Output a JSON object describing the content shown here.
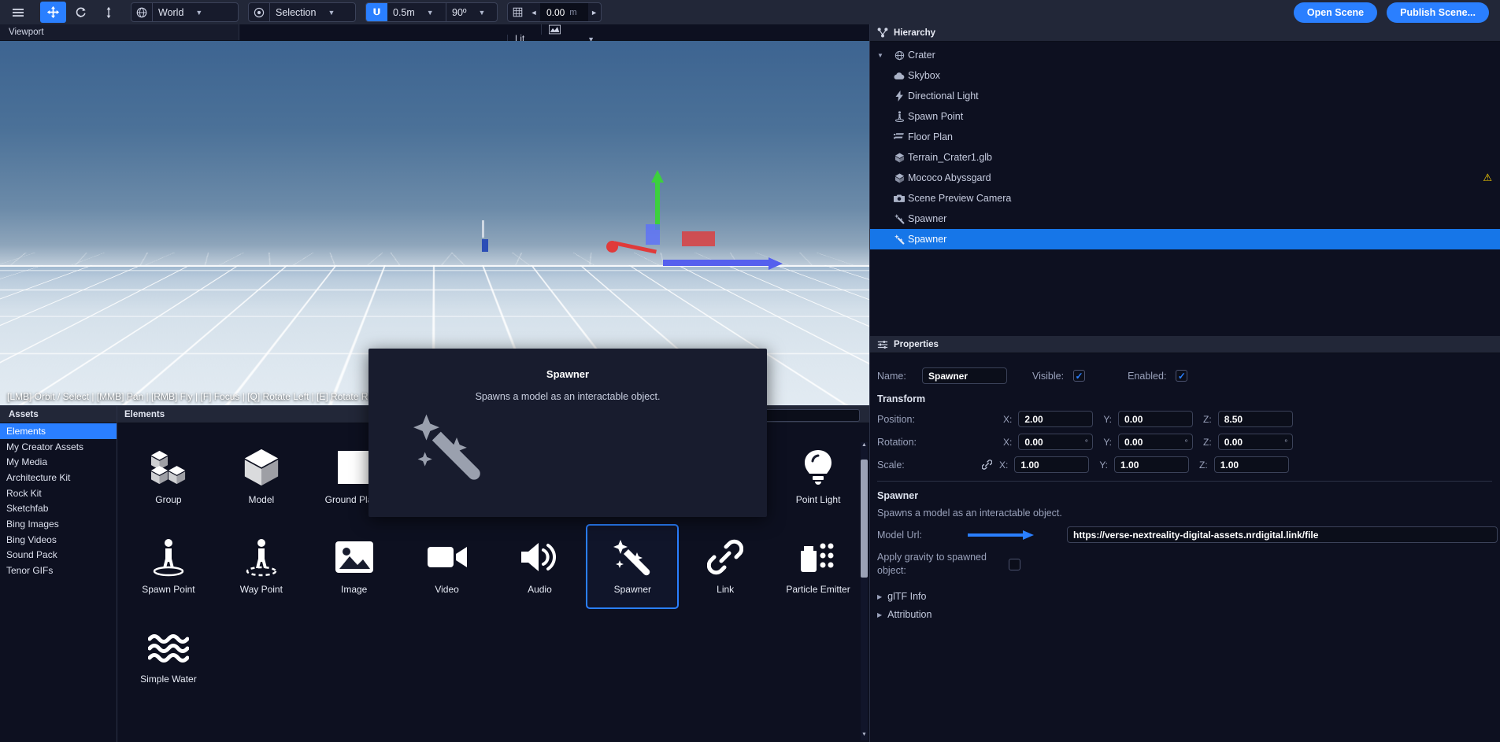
{
  "toolbar": {
    "menu_icon": "hamburger-menu-icon",
    "tools": [
      {
        "name": "move-tool",
        "icon": "move-arrows-icon",
        "active": true
      },
      {
        "name": "rotate-tool",
        "icon": "rotate-icon",
        "active": false
      },
      {
        "name": "scale-tool",
        "icon": "scale-vertical-icon",
        "active": false
      }
    ],
    "coord_space": {
      "icon": "globe-icon",
      "value": "World"
    },
    "pivot": {
      "icon": "target-icon",
      "value": "Selection"
    },
    "snap": {
      "icon": "magnet-icon",
      "translate": "0.5m",
      "rotate": "90º"
    },
    "grid": {
      "icon": "grid-icon",
      "value": "0.00",
      "unit": "m",
      "left_arrow": "◄",
      "right_arrow": "►"
    },
    "open_scene": "Open Scene",
    "publish_scene": "Publish Scene..."
  },
  "viewport": {
    "title": "Viewport",
    "stats_icon": "chart-icon",
    "shading": "Lit",
    "hint": "[LMB] Orbit / Select | [MMB] Pan | [RMB] Fly | [F] Focus | [Q] Rotate Left | [E] Rotate Right| [G] G"
  },
  "tooltip": {
    "title": "Spawner",
    "description": "Spawns a model as an interactable object.",
    "icon": "magic-wand-icon"
  },
  "assets": {
    "panel_title": "Assets",
    "categories": [
      {
        "label": "Elements",
        "selected": true
      },
      {
        "label": "My Creator Assets",
        "selected": false
      },
      {
        "label": "My Media",
        "selected": false
      },
      {
        "label": "Architecture Kit",
        "selected": false
      },
      {
        "label": "Rock Kit",
        "selected": false
      },
      {
        "label": "Sketchfab",
        "selected": false
      },
      {
        "label": "Bing Images",
        "selected": false
      },
      {
        "label": "Bing Videos",
        "selected": false
      },
      {
        "label": "Sound Pack",
        "selected": false
      },
      {
        "label": "Tenor GIFs",
        "selected": false
      }
    ],
    "content_title": "Elements",
    "search_placeholder": "",
    "search_value": "",
    "items": [
      {
        "label": "Group",
        "icon": "group-cubes-icon",
        "selected": false
      },
      {
        "label": "Model",
        "icon": "cube-icon",
        "selected": false
      },
      {
        "label": "Ground Plane",
        "icon": "square-icon",
        "selected": false
      },
      {
        "label": "",
        "icon": "",
        "selected": false
      },
      {
        "label": "",
        "icon": "",
        "selected": false
      },
      {
        "label": "",
        "icon": "",
        "selected": false
      },
      {
        "label": "",
        "icon": "",
        "selected": false
      },
      {
        "label": "Point Light",
        "icon": "bulb-icon",
        "selected": false
      },
      {
        "label": "Spawn Point",
        "icon": "spawn-point-icon",
        "selected": false
      },
      {
        "label": "Way Point",
        "icon": "way-point-icon",
        "selected": false
      },
      {
        "label": "Image",
        "icon": "image-icon",
        "selected": false
      },
      {
        "label": "Video",
        "icon": "video-camera-icon",
        "selected": false
      },
      {
        "label": "Audio",
        "icon": "speaker-icon",
        "selected": false
      },
      {
        "label": "Spawner",
        "icon": "magic-wand-icon",
        "selected": true
      },
      {
        "label": "Link",
        "icon": "link-chain-icon",
        "selected": false
      },
      {
        "label": "Particle Emitter",
        "icon": "particle-emitter-icon",
        "selected": false
      },
      {
        "label": "Simple Water",
        "icon": "water-waves-icon",
        "selected": false
      }
    ]
  },
  "hierarchy": {
    "panel_title": "Hierarchy",
    "panel_icon": "hierarchy-icon",
    "items": [
      {
        "label": "Crater",
        "icon": "globe-icon",
        "depth": 0,
        "expanded": true,
        "selected": false,
        "warning": false
      },
      {
        "label": "Skybox",
        "icon": "cloud-icon",
        "depth": 1,
        "selected": false,
        "warning": false
      },
      {
        "label": "Directional Light",
        "icon": "lightning-icon",
        "depth": 1,
        "selected": false,
        "warning": false
      },
      {
        "label": "Spawn Point",
        "icon": "spawn-point-icon",
        "depth": 1,
        "selected": false,
        "warning": false
      },
      {
        "label": "Floor Plan",
        "icon": "floor-plan-icon",
        "depth": 1,
        "selected": false,
        "warning": false
      },
      {
        "label": "Terrain_Crater1.glb",
        "icon": "cube-icon",
        "depth": 1,
        "selected": false,
        "warning": false
      },
      {
        "label": "Mococo Abyssgard",
        "icon": "cube-icon",
        "depth": 1,
        "selected": false,
        "warning": true
      },
      {
        "label": "Scene Preview Camera",
        "icon": "camera-icon",
        "depth": 1,
        "selected": false,
        "warning": false
      },
      {
        "label": "Spawner",
        "icon": "magic-wand-icon",
        "depth": 1,
        "selected": false,
        "warning": false
      },
      {
        "label": "Spawner",
        "icon": "magic-wand-icon",
        "depth": 1,
        "selected": true,
        "warning": false
      }
    ]
  },
  "properties": {
    "panel_title": "Properties",
    "panel_icon": "sliders-icon",
    "name_label": "Name:",
    "name_value": "Spawner",
    "visible_label": "Visible:",
    "visible_checked": true,
    "enabled_label": "Enabled:",
    "enabled_checked": true,
    "transform_title": "Transform",
    "position_label": "Position:",
    "position": {
      "x": "2.00",
      "y": "0.00",
      "z": "8.50"
    },
    "rotation_label": "Rotation:",
    "rotation": {
      "x": "0.00",
      "y": "0.00",
      "z": "0.00"
    },
    "rotation_unit": "º",
    "scale_label": "Scale:",
    "scale_link_icon": "link-chain-icon",
    "scale": {
      "x": "1.00",
      "y": "1.00",
      "z": "1.00"
    },
    "axis_x": "X:",
    "axis_y": "Y:",
    "axis_z": "Z:",
    "spawner_title": "Spawner",
    "spawner_desc": "Spawns a model as an interactable object.",
    "model_url_label": "Model Url:",
    "model_url_value": "https://verse-nextreality-digital-assets.nrdigital.link/file",
    "gravity_label": "Apply gravity to spawned object:",
    "gravity_checked": false,
    "gltf_info_label": "glTF Info",
    "attribution_label": "Attribution",
    "collapse_arrow": "▶"
  },
  "colors": {
    "accent": "#2a7fff",
    "panel": "#222738",
    "background": "#0d1020",
    "selection": "#1676e8",
    "warning": "#ffd400"
  }
}
